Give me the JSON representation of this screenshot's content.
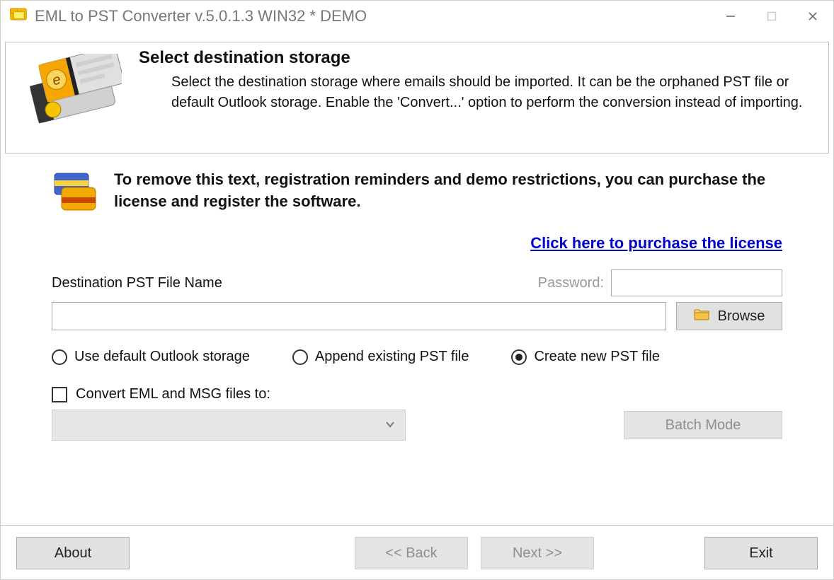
{
  "window": {
    "title": "EML to PST Converter v.5.0.1.3 WIN32 * DEMO"
  },
  "header": {
    "title": "Select destination storage",
    "desc": "Select the destination storage where emails should be imported. It can be the orphaned PST file or default Outlook storage. Enable the 'Convert...' option to perform the conversion instead of importing."
  },
  "nag": {
    "text": "To remove this text, registration reminders and demo restrictions, you can purchase the license and register the software.",
    "link_label": "Click here to purchase the license"
  },
  "dest": {
    "label": "Destination PST File Name",
    "password_label": "Password:",
    "password_value": "",
    "path_value": "",
    "browse_label": "Browse"
  },
  "radios": {
    "default_outlook": "Use default Outlook storage",
    "append_existing": "Append existing PST file",
    "create_new": "Create new PST file",
    "selected": "create_new"
  },
  "convert": {
    "check_label": "Convert EML and MSG files to:",
    "checked": false,
    "dropdown_value": ""
  },
  "batch_mode_label": "Batch Mode",
  "footer": {
    "about": "About",
    "back": "<< Back",
    "next": "Next >>",
    "exit": "Exit"
  },
  "icons": {
    "folder": "folder-icon",
    "chevron_down": "chevron-down-icon"
  }
}
